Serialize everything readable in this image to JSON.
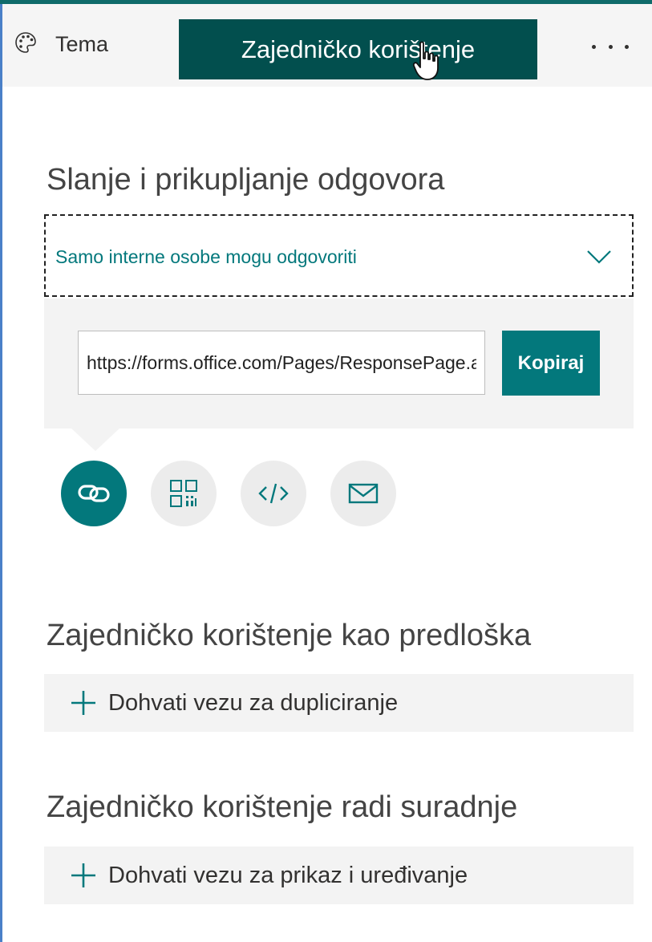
{
  "toolbar": {
    "theme_label": "Tema",
    "theme_icon": "palette-icon",
    "share_label": "Zajedničko korištenje",
    "more_icon": "more-options-icon"
  },
  "send": {
    "heading": "Slanje i prikupljanje odgovora",
    "audience_value": "Samo interne osobe mogu odgovoriti",
    "link_url": "https://forms.office.com/Pages/ResponsePage.aspx",
    "copy_label": "Kopiraj",
    "methods": [
      {
        "icon": "link-icon",
        "active": true
      },
      {
        "icon": "qr-code-icon",
        "active": false
      },
      {
        "icon": "embed-code-icon",
        "active": false
      },
      {
        "icon": "email-icon",
        "active": false
      }
    ]
  },
  "template": {
    "heading": "Zajedničko korištenje kao predloška",
    "action_label": "Dohvati vezu za dupliciranje"
  },
  "collaborate": {
    "heading": "Zajedničko korištenje radi suradnje",
    "action_label": "Dohvati vezu za prikaz i uređivanje"
  },
  "colors": {
    "accent": "#03787c",
    "tab_active": "#024f4e",
    "panel_bg": "#f3f3f3"
  }
}
